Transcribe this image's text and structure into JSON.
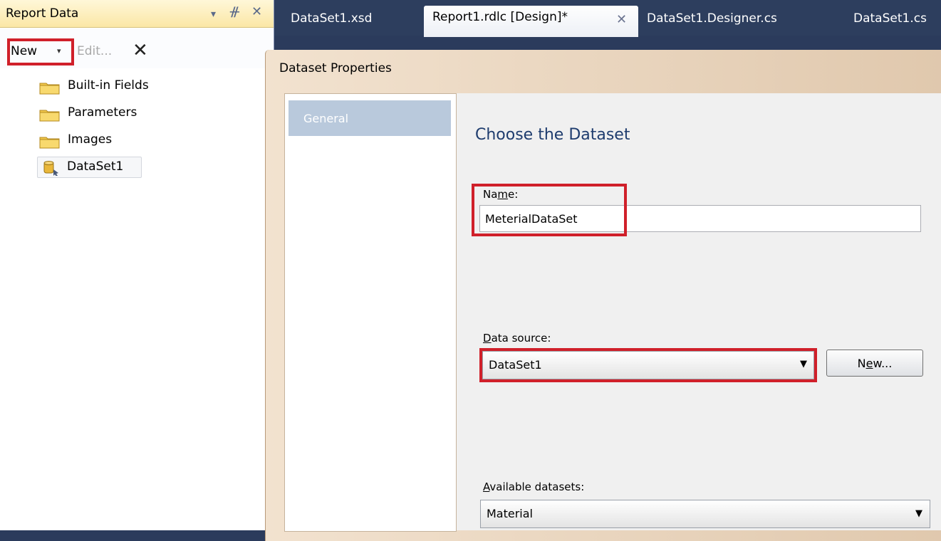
{
  "report_data_panel": {
    "title": "Report Data",
    "dropdown_icon": "▾",
    "pin_icon": "ᚌ",
    "close_icon": "✕",
    "toolbar": {
      "new_label": "New",
      "new_caret": "▾",
      "edit_label": "Edit...",
      "delete_icon": "✕"
    },
    "tree": [
      {
        "label": "Built-in Fields",
        "icon": "folder-icon"
      },
      {
        "label": "Parameters",
        "icon": "folder-icon"
      },
      {
        "label": "Images",
        "icon": "folder-icon"
      },
      {
        "label": "DataSet1",
        "icon": "dataset-icon"
      }
    ]
  },
  "tabs": [
    {
      "label": "DataSet1.xsd"
    },
    {
      "label": "Report1.rdlc [Design]*",
      "active": true,
      "close_icon": "✕"
    },
    {
      "label": "DataSet1.Designer.cs"
    },
    {
      "label": "DataSet1.cs"
    }
  ],
  "dialog": {
    "title": "Dataset Properties",
    "nav": [
      {
        "label": "General",
        "selected": true
      }
    ],
    "heading": "Choose the Dataset",
    "name": {
      "label_pre": "Na",
      "label_key": "m",
      "label_post": "e:",
      "value": "MeterialDataSet"
    },
    "data_source": {
      "label_key": "D",
      "label_post": "ata source:",
      "value": "DataSet1",
      "caret": "▼"
    },
    "new_button": {
      "label_pre": "N",
      "label_key": "e",
      "label_post": "w..."
    },
    "available_datasets": {
      "label_key": "A",
      "label_post": "vailable datasets:",
      "value": "Material",
      "caret": "▼"
    }
  },
  "colors": {
    "highlight": "#d0202a",
    "heading": "#1e3c6e",
    "ide_dark": "#2d3e5e"
  }
}
